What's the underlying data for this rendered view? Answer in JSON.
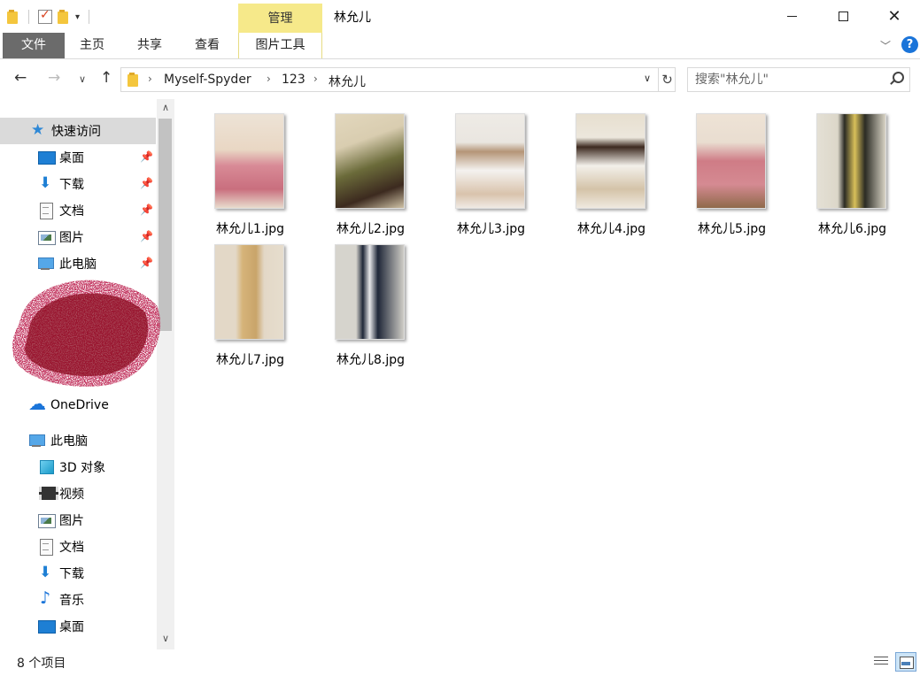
{
  "window": {
    "title": "林允儿",
    "context_tab": "管理",
    "controls": {
      "minimize": "minimize-icon",
      "maximize": "maximize-icon",
      "close": "✕"
    }
  },
  "quick_access_toolbar": {
    "icons": [
      "folder-icon",
      "properties-icon",
      "new-folder-icon"
    ],
    "dropdown": "▾"
  },
  "ribbon": {
    "tabs": [
      {
        "label": "文件"
      },
      {
        "label": "主页"
      },
      {
        "label": "共享"
      },
      {
        "label": "查看"
      },
      {
        "label": "图片工具"
      }
    ],
    "collapse": "﹀",
    "help": "?"
  },
  "navigation": {
    "back": "←",
    "forward": "→",
    "recent": "∨",
    "up": "↑",
    "refresh": "↻"
  },
  "address": {
    "crumbs": [
      "Myself-Spyder",
      "123",
      "林允儿"
    ],
    "separator": "›",
    "dropdown": "∨"
  },
  "search": {
    "placeholder": "搜索\"林允儿\""
  },
  "nav_pane": {
    "quick_access": {
      "label": "快速访问",
      "icon": "star-icon"
    },
    "pinned": [
      {
        "label": "桌面",
        "icon": "desktop-icon",
        "pinned": true
      },
      {
        "label": "下载",
        "icon": "download-icon",
        "pinned": true
      },
      {
        "label": "文档",
        "icon": "document-icon",
        "pinned": true
      },
      {
        "label": "图片",
        "icon": "pictures-icon",
        "pinned": true
      },
      {
        "label": "此电脑",
        "icon": "computer-icon",
        "pinned": true
      }
    ],
    "onedrive": {
      "label": "OneDrive",
      "icon": "cloud-icon"
    },
    "this_pc": {
      "label": "此电脑",
      "icon": "computer-icon"
    },
    "pc_items": [
      {
        "label": "3D 对象",
        "icon": "3d-objects-icon"
      },
      {
        "label": "视频",
        "icon": "video-icon"
      },
      {
        "label": "图片",
        "icon": "pictures-icon"
      },
      {
        "label": "文档",
        "icon": "document-icon"
      },
      {
        "label": "下载",
        "icon": "download-icon"
      },
      {
        "label": "音乐",
        "icon": "music-icon"
      },
      {
        "label": "桌面",
        "icon": "desktop-icon"
      }
    ],
    "scroll": {
      "up": "∧",
      "down": "∨"
    },
    "pin_glyph": "📌"
  },
  "files": [
    {
      "name": "林允儿1.jpg",
      "colors": [
        "#e9d7c4",
        "#d88a96",
        "#5a3a2e"
      ]
    },
    {
      "name": "林允儿2.jpg",
      "colors": [
        "#d9cdb0",
        "#6b6b3a",
        "#3c2a1f"
      ]
    },
    {
      "name": "林允儿3.jpg",
      "colors": [
        "#eae6e0",
        "#b59577",
        "#4a3023"
      ]
    },
    {
      "name": "林允儿4.jpg",
      "colors": [
        "#ece7dc",
        "#d4c3a8",
        "#3d2a20"
      ]
    },
    {
      "name": "林允儿5.jpg",
      "colors": [
        "#e9ddd0",
        "#cf7c86",
        "#8f6a4a"
      ]
    },
    {
      "name": "林允儿6.jpg",
      "colors": [
        "#dcd7c9",
        "#2b2b24",
        "#d8c05a"
      ]
    },
    {
      "name": "林允儿7.jpg",
      "colors": [
        "#e3d8c7",
        "#d6b47a",
        "#4b3528"
      ]
    },
    {
      "name": "林允儿8.jpg",
      "colors": [
        "#d6d4cd",
        "#1f2738",
        "#e8e8ea"
      ]
    }
  ],
  "status": {
    "count": "8 个项目"
  },
  "views": {
    "details": "details-view-icon",
    "large_icons": "large-icons-view-icon"
  },
  "colors": {
    "file_tab": "#6b6b6b",
    "manage_tab": "#f6e98a",
    "selected_row": "#dadada",
    "accent": "#1a74d9",
    "redaction": "#8b0a1f"
  }
}
